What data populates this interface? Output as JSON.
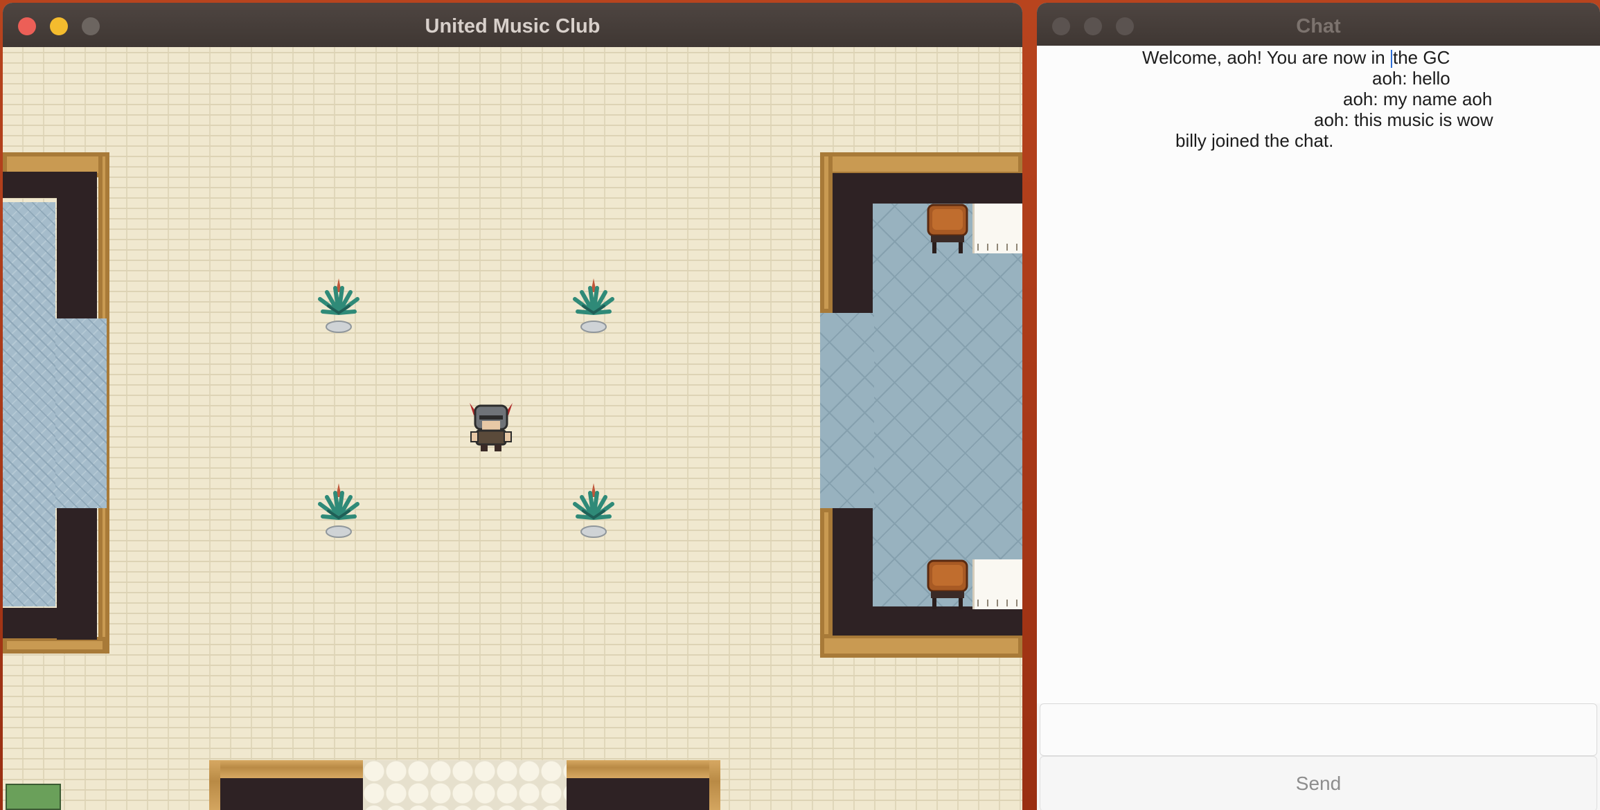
{
  "game_window": {
    "title": "United Music Club"
  },
  "chat_window": {
    "title": "Chat",
    "messages": [
      "Welcome, aoh! You are now in the GC",
      "aoh: hello",
      "aoh: my name aoh",
      "aoh: this music is wow",
      "billy joined the chat."
    ],
    "input_value": "",
    "send_label": "Send"
  },
  "colors": {
    "close": "#ec5f57",
    "minimize": "#f4bc2e",
    "floor": "#f0e8cf",
    "blue_tile": "#98b2bf"
  }
}
